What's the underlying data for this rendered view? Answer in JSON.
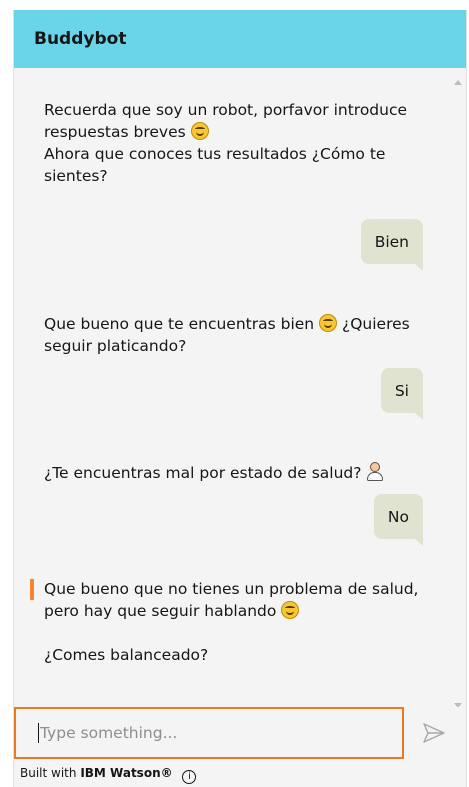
{
  "header": {
    "title": "Buddybot"
  },
  "messages": {
    "bot1": {
      "line1": "Recuerda que soy un robot, porfavor introduce respuestas breves",
      "line2": "Ahora que conoces tus resultados ¿Cómo te sientes?"
    },
    "user1": "Bien",
    "bot2": {
      "text_before": "Que bueno que te encuentras bien",
      "text_after": "¿Quieres seguir platicando?"
    },
    "user2": "Si",
    "bot3": {
      "text": "¿Te encuentras mal por estado de salud?"
    },
    "user3": "No",
    "bot4": {
      "line1": "Que bueno que no tienes un problema de salud, pero hay que seguir hablando",
      "line2": "¿Comes balanceado?"
    }
  },
  "icons": {
    "smile": "smiling-face-icon",
    "doctor": "health-worker-icon",
    "send": "send-icon",
    "info": "info-icon"
  },
  "input": {
    "placeholder": "Type something..."
  },
  "footer": {
    "prefix": "Built with",
    "brand": "IBM Watson®",
    "info_glyph": "i"
  },
  "colors": {
    "header": "#6ad5e8",
    "panel": "#f4f4f4",
    "user_bubble": "#dfe3cf",
    "focus_accent": "#e87b22"
  }
}
